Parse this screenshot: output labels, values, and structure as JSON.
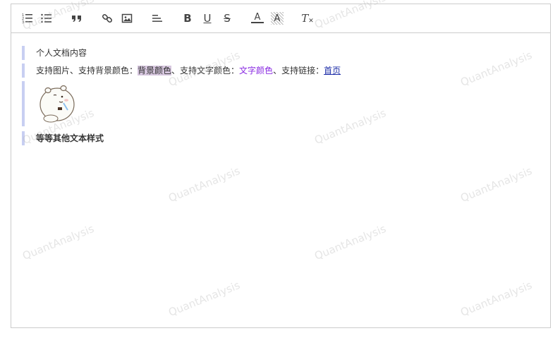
{
  "toolbar": {
    "buttons": [
      {
        "name": "ordered-list-icon"
      },
      {
        "name": "unordered-list-icon"
      },
      {
        "name": "blockquote-icon"
      },
      {
        "name": "link-icon"
      },
      {
        "name": "image-icon"
      },
      {
        "name": "align-left-icon"
      },
      {
        "name": "bold-icon",
        "label": "B"
      },
      {
        "name": "underline-icon",
        "label": "U"
      },
      {
        "name": "strikethrough-icon",
        "label": "S"
      },
      {
        "name": "font-color-icon",
        "label": "A"
      },
      {
        "name": "background-color-icon",
        "label": "A"
      },
      {
        "name": "clear-format-icon",
        "label": "T"
      }
    ]
  },
  "content": {
    "line1": "个人文档内容",
    "line2": {
      "part1": "支持图片、支持背景颜色：",
      "highlight": "背景颜色",
      "part2": "、支持文字颜色：",
      "colored": "文字颜色",
      "part3": "、支持链接：",
      "link": "首页"
    },
    "line4": "等等其他文本样式"
  },
  "watermark": "QuantAnalysis",
  "colors": {
    "quote_border": "#c8cff2",
    "highlight_bg": "#d7c7df",
    "text_color": "#8a2be2",
    "link_color": "#1e2ea8"
  }
}
